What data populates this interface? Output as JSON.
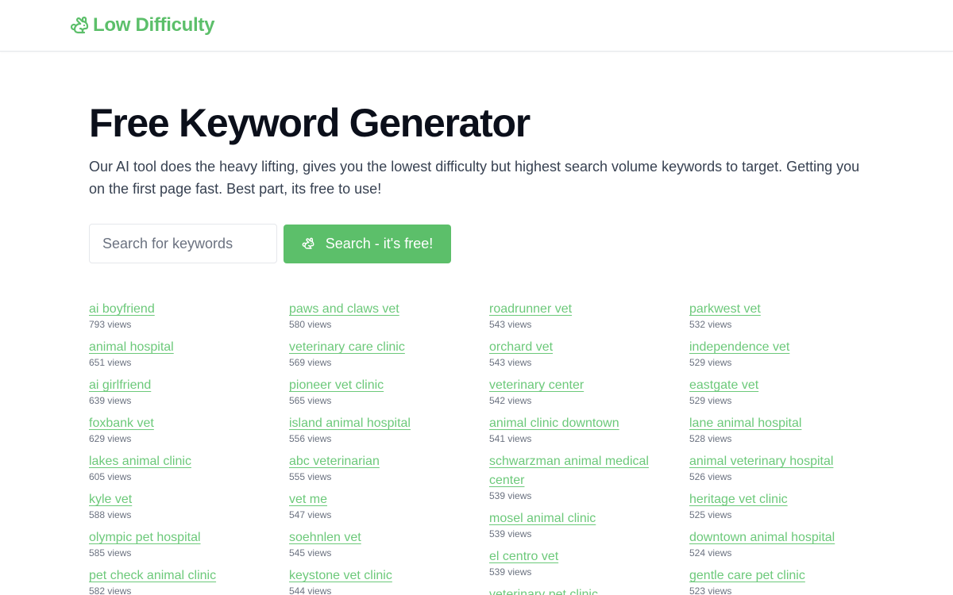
{
  "header": {
    "brand": "Low Difficulty",
    "brand_icon": "rabbit-icon",
    "brand_color": "#5cbf6a"
  },
  "hero": {
    "title": "Free Keyword Generator",
    "subtitle": "Our AI tool does the heavy lifting, gives you the lowest difficulty but highest search volume keywords to target. Getting you on the first page fast. Best part, its free to use!"
  },
  "search": {
    "placeholder": "Search for keywords",
    "value": "",
    "button_label": "Search - it's free!",
    "button_icon": "rabbit-icon"
  },
  "keywords": {
    "columns": [
      [
        {
          "keyword": "ai boyfriend",
          "views": "793 views"
        },
        {
          "keyword": "animal hospital",
          "views": "651 views"
        },
        {
          "keyword": "ai girlfriend",
          "views": "639 views"
        },
        {
          "keyword": "foxbank vet",
          "views": "629 views"
        },
        {
          "keyword": "lakes animal clinic",
          "views": "605 views"
        },
        {
          "keyword": "kyle vet",
          "views": "588 views"
        },
        {
          "keyword": "olympic pet hospital",
          "views": "585 views"
        },
        {
          "keyword": "pet check animal clinic",
          "views": "582 views"
        }
      ],
      [
        {
          "keyword": "paws and claws vet",
          "views": "580 views"
        },
        {
          "keyword": "veterinary care clinic",
          "views": "569 views"
        },
        {
          "keyword": "pioneer vet clinic",
          "views": "565 views"
        },
        {
          "keyword": "island animal hospital",
          "views": "556 views"
        },
        {
          "keyword": "abc veterinarian",
          "views": "555 views"
        },
        {
          "keyword": "vet me",
          "views": "547 views"
        },
        {
          "keyword": "soehnlen vet",
          "views": "545 views"
        },
        {
          "keyword": "keystone vet clinic",
          "views": "544 views"
        }
      ],
      [
        {
          "keyword": "roadrunner vet",
          "views": "543 views"
        },
        {
          "keyword": "orchard vet",
          "views": "543 views"
        },
        {
          "keyword": "veterinary center",
          "views": "542 views"
        },
        {
          "keyword": "animal clinic downtown",
          "views": "541 views"
        },
        {
          "keyword": "schwarzman animal medical center",
          "views": "539 views"
        },
        {
          "keyword": "mosel animal clinic",
          "views": "539 views"
        },
        {
          "keyword": "el centro vet",
          "views": "539 views"
        },
        {
          "keyword": "veterinary pet clinic",
          "views": ""
        }
      ],
      [
        {
          "keyword": "parkwest vet",
          "views": "532 views"
        },
        {
          "keyword": "independence vet",
          "views": "529 views"
        },
        {
          "keyword": "eastgate vet",
          "views": "529 views"
        },
        {
          "keyword": "lane animal hospital",
          "views": "528 views"
        },
        {
          "keyword": "animal veterinary hospital",
          "views": "526 views"
        },
        {
          "keyword": "heritage vet clinic",
          "views": "525 views"
        },
        {
          "keyword": "downtown animal hospital",
          "views": "524 views"
        },
        {
          "keyword": "gentle care pet clinic",
          "views": "523 views"
        }
      ]
    ]
  }
}
